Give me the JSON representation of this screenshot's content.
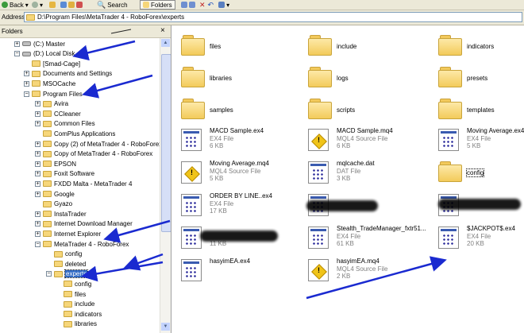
{
  "toolbar": {
    "back_label": "Back",
    "search_label": "Search",
    "folders_label": "Folders"
  },
  "address": {
    "label": "Address",
    "value": "D:\\Program Files\\MetaTrader 4 - RoboForex\\experts"
  },
  "folders_pane": {
    "title": "Folders",
    "close": "×",
    "tree": [
      {
        "label": "(C:) Master",
        "indent": 0,
        "expander": "+",
        "icon": "drive-icon"
      },
      {
        "label": "(D:) Local Disk",
        "indent": 0,
        "expander": "−",
        "icon": "drive-icon"
      },
      {
        "label": "[Smad-Cage]",
        "indent": 1,
        "expander": "",
        "icon": "folder-icon"
      },
      {
        "label": "Documents and Settings",
        "indent": 1,
        "expander": "+",
        "icon": "folder-icon"
      },
      {
        "label": "MSOCache",
        "indent": 1,
        "expander": "+",
        "icon": "folder-icon"
      },
      {
        "label": "Program Files",
        "indent": 1,
        "expander": "−",
        "icon": "folder-icon"
      },
      {
        "label": "Avira",
        "indent": 2,
        "expander": "+",
        "icon": "folder-icon"
      },
      {
        "label": "CCleaner",
        "indent": 2,
        "expander": "+",
        "icon": "folder-icon"
      },
      {
        "label": "Common Files",
        "indent": 2,
        "expander": "+",
        "icon": "folder-icon"
      },
      {
        "label": "ComPlus Applications",
        "indent": 2,
        "expander": "",
        "icon": "folder-icon"
      },
      {
        "label": "Copy (2) of MetaTrader 4 - RoboForex",
        "indent": 2,
        "expander": "+",
        "icon": "folder-icon"
      },
      {
        "label": "Copy of MetaTrader 4 - RoboForex",
        "indent": 2,
        "expander": "+",
        "icon": "folder-icon"
      },
      {
        "label": "EPSON",
        "indent": 2,
        "expander": "+",
        "icon": "folder-icon"
      },
      {
        "label": "Foxit Software",
        "indent": 2,
        "expander": "+",
        "icon": "folder-icon"
      },
      {
        "label": "FXDD Malta - MetaTrader 4",
        "indent": 2,
        "expander": "+",
        "icon": "folder-icon"
      },
      {
        "label": "Google",
        "indent": 2,
        "expander": "+",
        "icon": "folder-icon"
      },
      {
        "label": "Gyazo",
        "indent": 2,
        "expander": "",
        "icon": "folder-icon"
      },
      {
        "label": "InstaTrader",
        "indent": 2,
        "expander": "+",
        "icon": "folder-icon"
      },
      {
        "label": "Internet Download Manager",
        "indent": 2,
        "expander": "+",
        "icon": "folder-icon"
      },
      {
        "label": "Internet Explorer",
        "indent": 2,
        "expander": "+",
        "icon": "folder-icon"
      },
      {
        "label": "MetaTrader 4 - RoboForex",
        "indent": 2,
        "expander": "−",
        "icon": "folder-icon"
      },
      {
        "label": "config",
        "indent": 3,
        "expander": "",
        "icon": "folder-icon"
      },
      {
        "label": "deleted",
        "indent": 3,
        "expander": "",
        "icon": "folder-icon"
      },
      {
        "label": "experts",
        "indent": 3,
        "expander": "−",
        "icon": "folder-icon",
        "selected": true
      },
      {
        "label": "config",
        "indent": 4,
        "expander": "",
        "icon": "folder-icon"
      },
      {
        "label": "files",
        "indent": 4,
        "expander": "",
        "icon": "folder-icon"
      },
      {
        "label": "include",
        "indent": 4,
        "expander": "",
        "icon": "folder-icon"
      },
      {
        "label": "indicators",
        "indent": 4,
        "expander": "",
        "icon": "folder-icon"
      },
      {
        "label": "libraries",
        "indent": 4,
        "expander": "",
        "icon": "folder-icon"
      }
    ]
  },
  "content": {
    "folders": [
      {
        "name": "files"
      },
      {
        "name": "include"
      },
      {
        "name": "indicators"
      },
      {
        "name": "libraries"
      },
      {
        "name": "logs"
      },
      {
        "name": "presets"
      },
      {
        "name": "samples"
      },
      {
        "name": "scripts"
      },
      {
        "name": "templates"
      }
    ],
    "files": [
      {
        "name": "MACD Sample.ex4",
        "type": "EX4 File",
        "size": "6 KB",
        "icon": "ex4-file-icon"
      },
      {
        "name": "MACD Sample.mq4",
        "type": "MQL4 Source File",
        "size": "6 KB",
        "icon": "mq4-file-icon"
      },
      {
        "name": "Moving Average.ex4",
        "type": "EX4 File",
        "size": "5 KB",
        "icon": "ex4-file-icon"
      },
      {
        "name": "Moving Average.mq4",
        "type": "MQL4 Source File",
        "size": "5 KB",
        "icon": "mq4-file-icon"
      },
      {
        "name": "mqlcache.dat",
        "type": "DAT File",
        "size": "3 KB",
        "icon": "dat-file-icon"
      },
      {
        "name": "config",
        "type": "",
        "size": "",
        "icon": "folder-icon"
      },
      {
        "name": "ORDER BY LINE..ex4",
        "type": "EX4 File",
        "size": "17 KB",
        "icon": "ex4-file-icon"
      },
      {
        "name": "",
        "type": "",
        "size": "",
        "icon": "ex4-file-icon"
      },
      {
        "name": "",
        "type": "",
        "size": "",
        "icon": "ex4-file-icon"
      },
      {
        "name": "",
        "type": "",
        "size": "11 KB",
        "icon": "ex4-file-icon"
      },
      {
        "name": "Stealth_TradeManager_fxtr51...",
        "type": "EX4 File",
        "size": "61 KB",
        "icon": "ex4-file-icon"
      },
      {
        "name": "$JACKPOT$.ex4",
        "type": "EX4 File",
        "size": "20 KB",
        "icon": "ex4-file-icon"
      },
      {
        "name": "hasyimEA.ex4",
        "type": "",
        "size": "",
        "icon": "ex4-file-icon"
      },
      {
        "name": "hasyimEA.mq4",
        "type": "MQL4 Source File",
        "size": "2 KB",
        "icon": "mq4-file-icon"
      }
    ]
  },
  "colors": {
    "selection": "#316ac5",
    "annotation_arrow": "#1a2ad0",
    "folder_fill": "#f6d67a"
  }
}
